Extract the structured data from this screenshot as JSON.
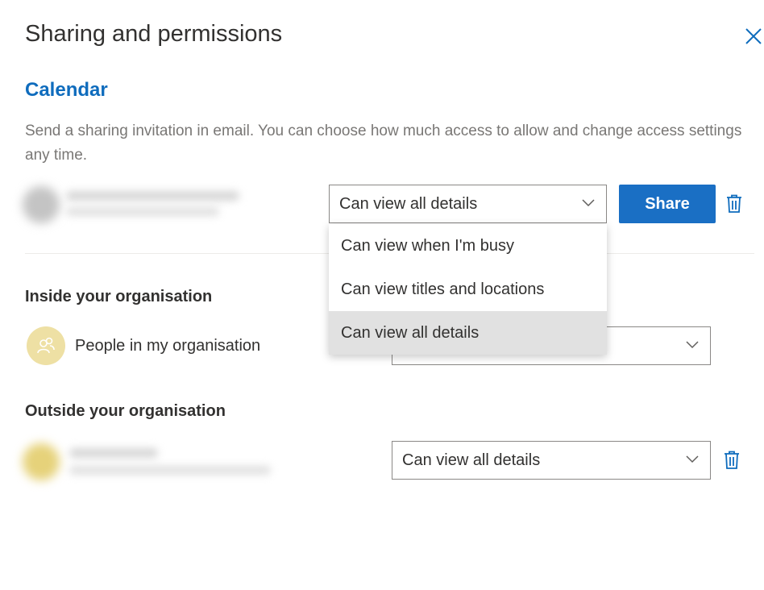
{
  "panel": {
    "title": "Sharing and permissions",
    "section_title": "Calendar",
    "description": "Send a sharing invitation in email. You can choose how much access to allow and change access settings any time."
  },
  "invite": {
    "permission_value": "Can view all details",
    "share_label": "Share"
  },
  "dropdown_menu": {
    "options": [
      "Can view when I'm busy",
      "Can view titles and locations",
      "Can view all details"
    ],
    "selected": "Can view all details"
  },
  "inside_org": {
    "heading": "Inside your organisation",
    "people_label": "People in my organisation",
    "permission_value": ""
  },
  "outside_org": {
    "heading": "Outside your organisation",
    "permission_value": "Can view all details"
  },
  "colors": {
    "accent": "#0f6cbd",
    "share_button": "#1a6fc4",
    "org_avatar": "#eee0a4"
  }
}
